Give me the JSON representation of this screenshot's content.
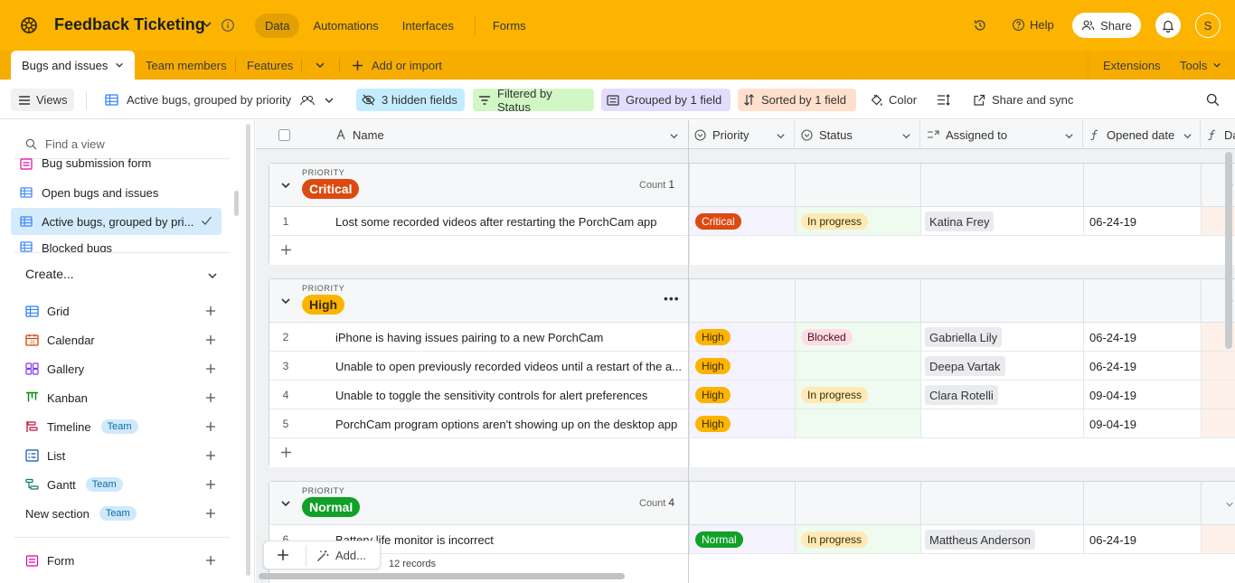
{
  "app": {
    "title": "Feedback Ticketing"
  },
  "topnav": {
    "items": [
      "Data",
      "Automations",
      "Interfaces",
      "Forms"
    ],
    "active": "Data"
  },
  "header_right": {
    "help": "Help",
    "share": "Share",
    "avatar_initial": "S"
  },
  "tables": {
    "active": "Bugs and issues",
    "others": [
      "Team members",
      "Features"
    ],
    "add": "Add or import",
    "extensions": "Extensions",
    "tools": "Tools"
  },
  "toolbar": {
    "views": "Views",
    "current_view": "Active bugs, grouped by priority",
    "hidden_fields": "3 hidden fields",
    "filtered": "Filtered by Status",
    "grouped": "Grouped by 1 field",
    "sorted": "Sorted by 1 field",
    "color": "Color",
    "share_sync": "Share and sync"
  },
  "sidebar": {
    "find_placeholder": "Find a view",
    "views": [
      {
        "label": "Bug submission form",
        "type": "form"
      },
      {
        "label": "Open bugs and issues",
        "type": "grid"
      },
      {
        "label": "Active bugs, grouped by pri...",
        "type": "grid",
        "selected": true
      },
      {
        "label": "Blocked bugs",
        "type": "grid"
      }
    ],
    "create": "Create...",
    "create_items": [
      "Grid",
      "Calendar",
      "Gallery",
      "Kanban",
      "Timeline",
      "List",
      "Gantt",
      "New section",
      "Form"
    ],
    "team_badge": "Team"
  },
  "columns": [
    "Name",
    "Priority",
    "Status",
    "Assigned to",
    "Opened date",
    "Da"
  ],
  "group_label": "PRIORITY",
  "count_label": "Count",
  "groups": [
    {
      "name": "Critical",
      "count": "1",
      "color": "#dc4a12",
      "rows": [
        {
          "num": "1",
          "name": "Lost some recorded videos after restarting the PorchCam app",
          "priority": "Critical",
          "status": "In progress",
          "assigned": "Katina Frey",
          "date": "06-24-19"
        }
      ]
    },
    {
      "name": "High",
      "count": "",
      "color": "#fcb400",
      "rows": [
        {
          "num": "2",
          "name": "iPhone is having issues pairing to a new PorchCam",
          "priority": "High",
          "status": "Blocked",
          "assigned": "Gabriella Lily",
          "date": "06-24-19"
        },
        {
          "num": "3",
          "name": "Unable to open previously recorded videos until a restart of the a...",
          "priority": "High",
          "status": "",
          "assigned": "Deepa Vartak",
          "date": "06-24-19"
        },
        {
          "num": "4",
          "name": "Unable to toggle the sensitivity controls for alert preferences",
          "priority": "High",
          "status": "In progress",
          "assigned": "Clara Rotelli",
          "date": "09-04-19"
        },
        {
          "num": "5",
          "name": "PorchCam program options aren't showing up on the desktop app",
          "priority": "High",
          "status": "",
          "assigned": "",
          "date": "09-04-19"
        }
      ]
    },
    {
      "name": "Normal",
      "count": "4",
      "color": "#11a028",
      "rows": [
        {
          "num": "6",
          "name": "Battery life monitor is incorrect",
          "priority": "Normal",
          "status": "In progress",
          "assigned": "Mattheus Anderson",
          "date": "06-24-19"
        }
      ]
    }
  ],
  "footer": {
    "add": "Add...",
    "records": "12 records"
  }
}
